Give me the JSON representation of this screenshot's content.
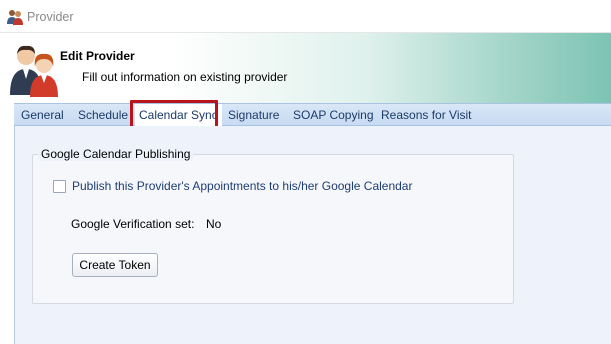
{
  "window": {
    "title": "Provider"
  },
  "header": {
    "title": "Edit Provider",
    "subtitle": "Fill out information on existing provider"
  },
  "tabs": [
    {
      "label": "General"
    },
    {
      "label": "Schedule"
    },
    {
      "label": "Calendar Sync",
      "active": true
    },
    {
      "label": "Signature"
    },
    {
      "label": "SOAP Copying"
    },
    {
      "label": "Reasons for Visit"
    }
  ],
  "calendar_sync": {
    "group_title": "Google Calendar Publishing",
    "publish_checkbox": {
      "label": "Publish this Provider's Appointments to his/her Google Calendar",
      "checked": false
    },
    "verification": {
      "label": "Google Verification set:",
      "value": "No"
    },
    "create_token_label": "Create Token"
  },
  "colors": {
    "highlight": "#b8141b",
    "tabstrip": "#c7dbf2",
    "header_gradient_end": "#7cc4b4",
    "link_text": "#1f3d72"
  },
  "icons": {
    "window": "providers-icon",
    "header": "providers-avatar-icon"
  }
}
